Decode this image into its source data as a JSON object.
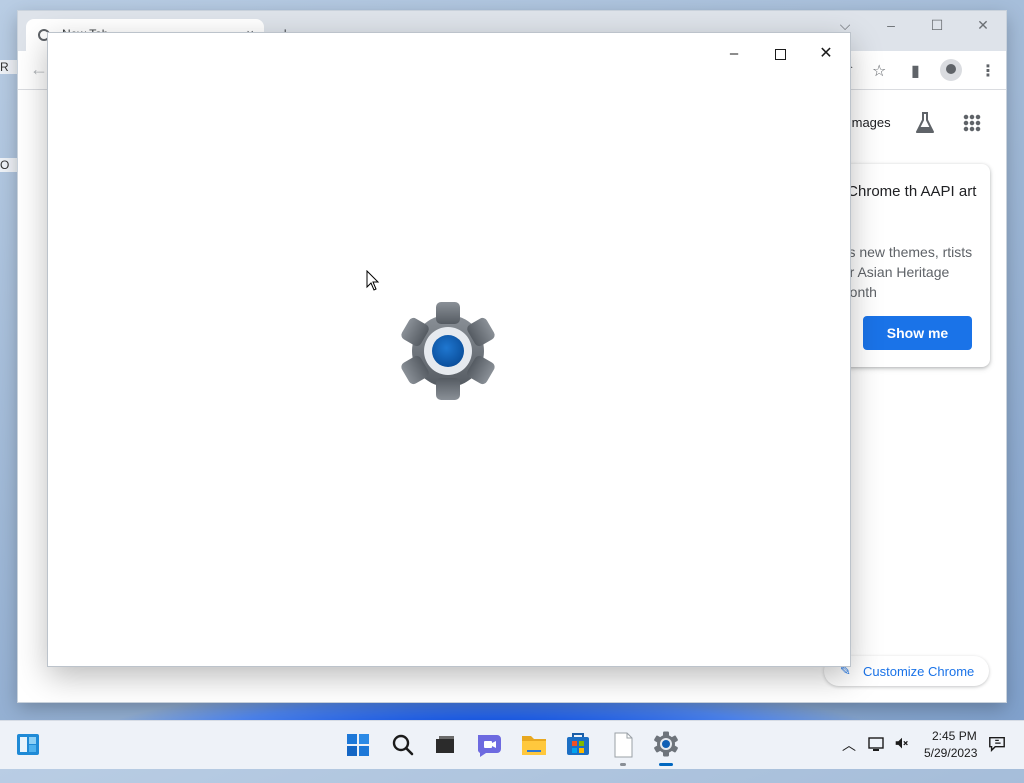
{
  "chrome": {
    "tab_title": "New Tab",
    "tab_close": "×",
    "new_tab": "+",
    "images_link": "Images",
    "promo": {
      "title": "r Chrome th AAPI art",
      "body": "e's new themes, rtists for Asian Heritage Month",
      "button": "Show me"
    },
    "customize": "Customize Chrome"
  },
  "settings_window": {
    "minimize": "–",
    "close": "✕"
  },
  "taskbar": {
    "time": "2:45 PM",
    "date": "5/29/2023"
  },
  "desktop_fragments": [
    "R",
    "O"
  ],
  "colors": {
    "accent": "#1a73e8",
    "win_accent": "#0067c0",
    "gear_body": "#6e747b",
    "gear_center": "#0f5fb5"
  }
}
